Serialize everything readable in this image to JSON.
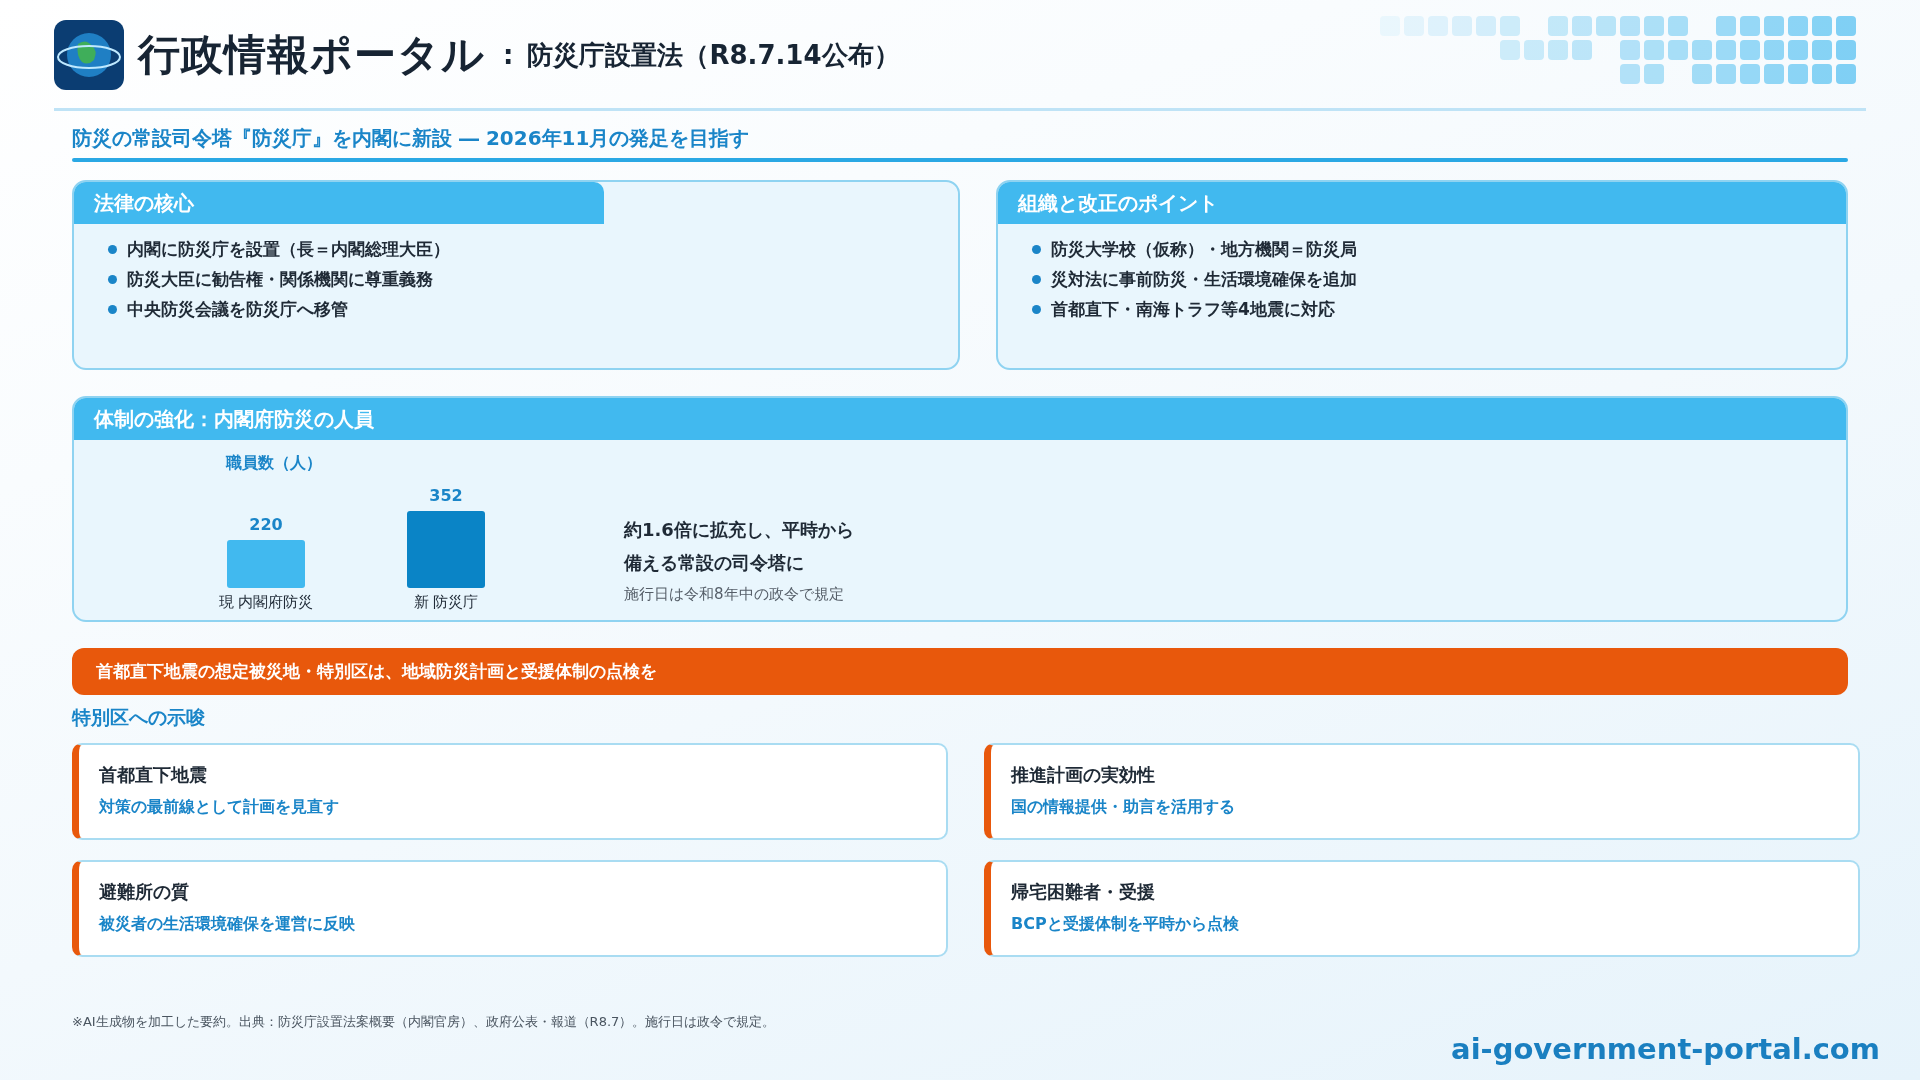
{
  "header": {
    "title": "行政情報ポータル",
    "separator": ":",
    "subtitle": "防災庁設置法（R8.7.14公布）"
  },
  "tagline": "防災の常設司令塔『防災庁』を内閣に新設 ― 2026年11月の発足を目指す",
  "summary_cards": [
    {
      "title": "法律の核心",
      "kind": "tab",
      "bullets": [
        "内閣に防災庁を設置（長＝内閣総理大臣）",
        "防災大臣に勧告権・関係機関に尊重義務",
        "中央防災会議を防災庁へ移管"
      ]
    },
    {
      "title": "組織と改正のポイント",
      "kind": "band",
      "bullets": [
        "防災大学校（仮称）・地方機関＝防災局",
        "災対法に事前防災・生活環境確保を追加",
        "首都直下・南海トラフ等4地震に対応"
      ]
    }
  ],
  "staffing_panel": {
    "title": "体制の強化：内閣府防災の人員",
    "chart_data": {
      "type": "bar",
      "title": "職員数（人）",
      "categories": [
        "現 内閣府防災",
        "新 防災庁"
      ],
      "series": [
        {
          "colors": [
            "#41b9ef",
            "#0a84c6"
          ],
          "values": [
            220,
            352
          ]
        }
      ],
      "data_labels": true
    },
    "message_lines": [
      "約1.6倍に拡充し、平時から",
      "備える常設の司令塔に"
    ],
    "note": "施行日は令和8年中の政令で規定"
  },
  "alert_banner": "首都直下地震の想定被災地・特別区は、地域防災計画と受援体制の点検を",
  "implications": {
    "heading": "特別区への示唆",
    "cards": [
      {
        "title": "首都直下地震",
        "text": "対策の最前線として計画を見直す"
      },
      {
        "title": "推進計画の実効性",
        "text": "国の情報提供・助言を活用する"
      },
      {
        "title": "避難所の質",
        "text": "被災者の生活環境確保を運営に反映"
      },
      {
        "title": "帰宅困難者・受援",
        "text": "BCPと受援体制を平時から点検"
      }
    ]
  },
  "footnote": "※AI生成物を加工した要約。出典：防災庁設置法案概要（内閣官房）、政府公表・報道（R8.7）。施行日は政令で規定。",
  "site_url": "ai-government-portal.com"
}
